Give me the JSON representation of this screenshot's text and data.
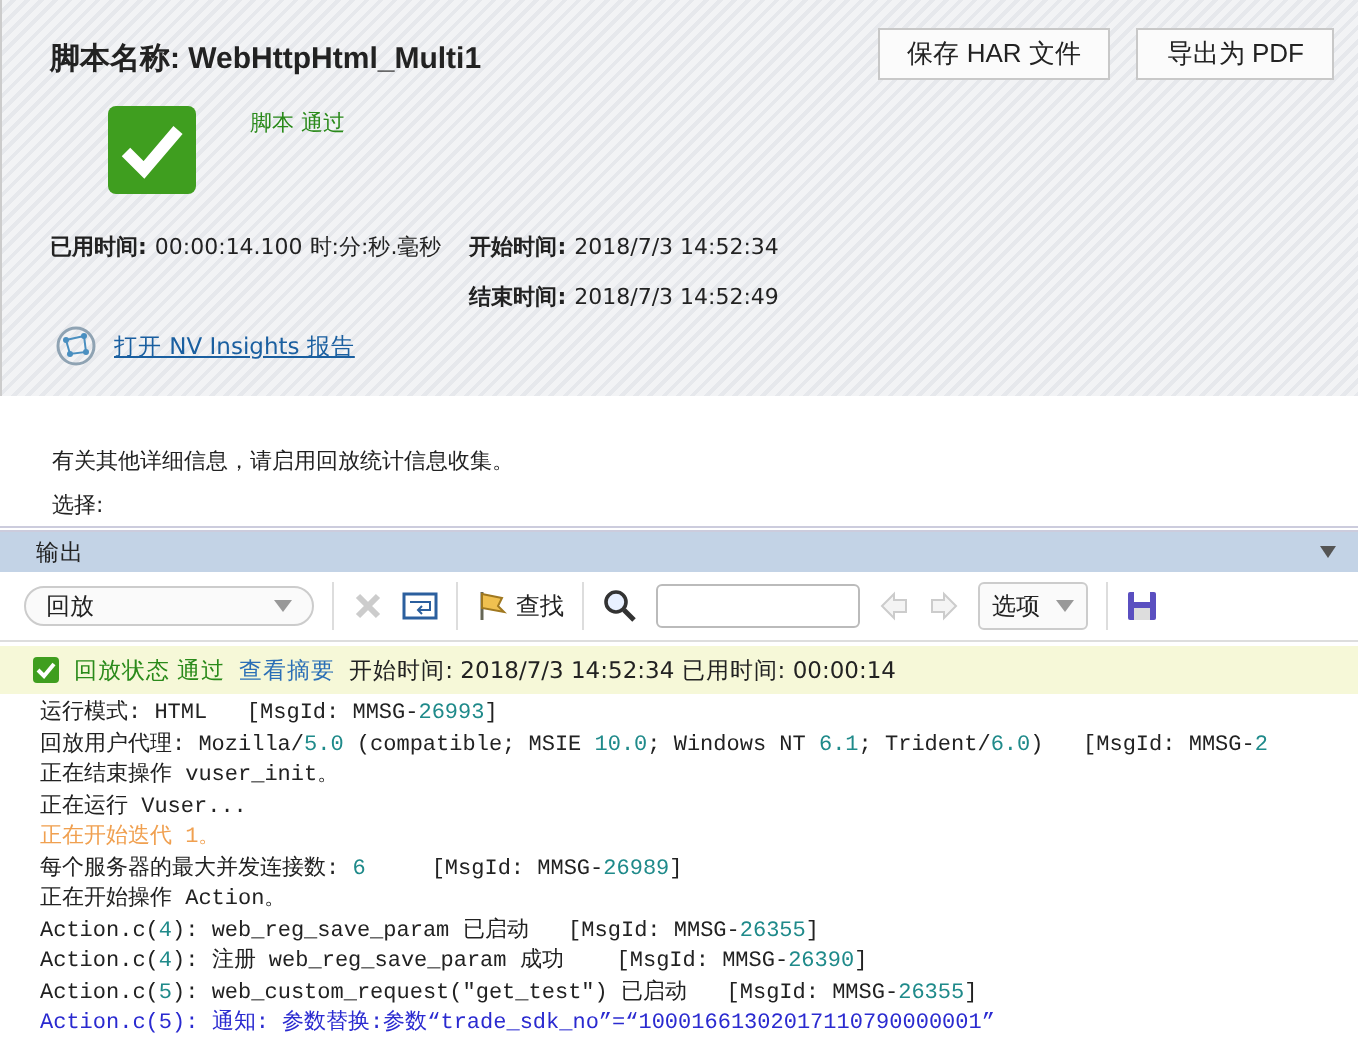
{
  "header": {
    "title": "脚本名称: WebHttpHtml_Multi1",
    "buttons": [
      "保存 HAR 文件",
      "导出为 PDF"
    ],
    "status": "脚本 通过",
    "passed": true
  },
  "times": [
    {
      "label": "已用时间:",
      "value": "00:00:14.100 时:分:秒.毫秒"
    },
    {
      "label": "开始时间:",
      "value": "2018/7/3 14:52:34"
    },
    {
      "label": "结束时间:",
      "value": "2018/7/3 14:52:49"
    }
  ],
  "insights_link": "打开 NV Insights 报告",
  "info": "有关其他详细信息，请启用回放统计信息收集。",
  "select_label": "选择:",
  "output": {
    "title": "输出",
    "dropdown": "回放",
    "find": "查找",
    "options": "选项",
    "status": {
      "state": "回放状态 通过",
      "summary_link": "查看摘要",
      "detail": "开始时间: 2018/7/3 14:52:34 已用时间: 00:00:14"
    },
    "lines": [
      {
        "kind": "normal",
        "parts": [
          {
            "t": "运行模式: HTML   [MsgId: MMSG-",
            "num": false
          },
          {
            "t": "26993",
            "num": true
          },
          {
            "t": "]",
            "num": false
          }
        ]
      },
      {
        "kind": "normal",
        "parts": [
          {
            "t": "回放用户代理: Mozilla/",
            "num": false
          },
          {
            "t": "5.0",
            "num": true
          },
          {
            "t": " (compatible; MSIE ",
            "num": false
          },
          {
            "t": "10.0",
            "num": true
          },
          {
            "t": "; Windows NT ",
            "num": false
          },
          {
            "t": "6.1",
            "num": true
          },
          {
            "t": "; Trident/",
            "num": false
          },
          {
            "t": "6.0",
            "num": true
          },
          {
            "t": ")   [MsgId: MMSG-",
            "num": false
          },
          {
            "t": "2",
            "num": true
          }
        ]
      },
      {
        "kind": "normal",
        "parts": [
          {
            "t": "正在结束操作 vuser_init。",
            "num": false
          }
        ]
      },
      {
        "kind": "normal",
        "parts": [
          {
            "t": "正在运行 Vuser...",
            "num": false
          }
        ]
      },
      {
        "kind": "warn",
        "parts": [
          {
            "t": "正在开始迭代 1。",
            "num": false
          }
        ]
      },
      {
        "kind": "normal",
        "parts": [
          {
            "t": "每个服务器的最大并发连接数: ",
            "num": false
          },
          {
            "t": "6",
            "num": true
          },
          {
            "t": "     [MsgId: MMSG-",
            "num": false
          },
          {
            "t": "26989",
            "num": true
          },
          {
            "t": "]",
            "num": false
          }
        ]
      },
      {
        "kind": "normal",
        "parts": [
          {
            "t": "正在开始操作 Action。",
            "num": false
          }
        ]
      },
      {
        "kind": "normal",
        "parts": [
          {
            "t": "Action.c(",
            "num": false
          },
          {
            "t": "4",
            "num": true
          },
          {
            "t": "): web_reg_save_param 已启动   [MsgId: MMSG-",
            "num": false
          },
          {
            "t": "26355",
            "num": true
          },
          {
            "t": "]",
            "num": false
          }
        ]
      },
      {
        "kind": "normal",
        "parts": [
          {
            "t": "Action.c(",
            "num": false
          },
          {
            "t": "4",
            "num": true
          },
          {
            "t": "): 注册 web_reg_save_param 成功    [MsgId: MMSG-",
            "num": false
          },
          {
            "t": "26390",
            "num": true
          },
          {
            "t": "]",
            "num": false
          }
        ]
      },
      {
        "kind": "normal",
        "parts": [
          {
            "t": "Action.c(",
            "num": false
          },
          {
            "t": "5",
            "num": true
          },
          {
            "t": "): web_custom_request(\"get_test\") 已启动   [MsgId: MMSG-",
            "num": false
          },
          {
            "t": "26355",
            "num": true
          },
          {
            "t": "]",
            "num": false
          }
        ]
      },
      {
        "kind": "note",
        "parts": [
          {
            "t": "Action.c(5): 通知: 参数替换:参数“trade_sdk_no”=“10001661302017110790000001”",
            "num": false
          }
        ]
      }
    ]
  }
}
